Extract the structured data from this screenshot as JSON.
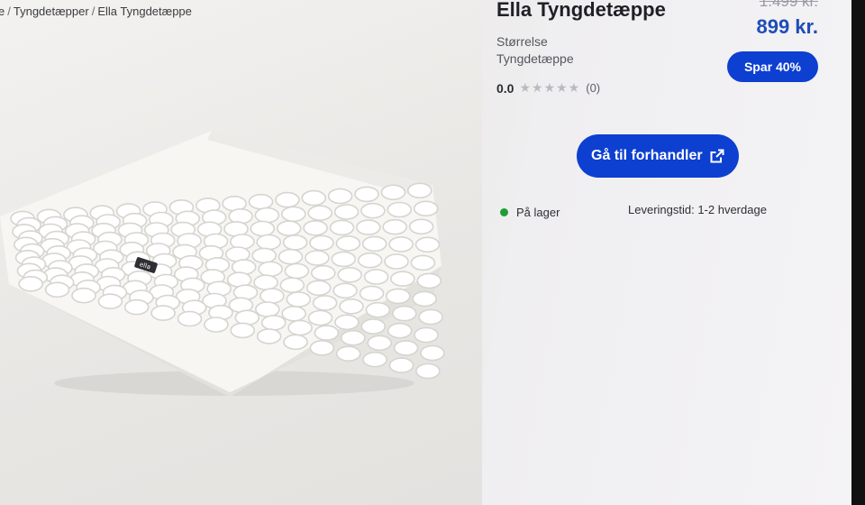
{
  "breadcrumb": {
    "items": [
      "e",
      "Tyngdetæpper",
      "Ella Tyngdetæppe"
    ],
    "separator": "/"
  },
  "product": {
    "title": "Ella Tyngdetæppe",
    "old_price": "1.499 kr.",
    "price": "899 kr.",
    "size_label": "Størrelse",
    "size_value": "Tyngdetæppe",
    "save_badge": "Spar 40%",
    "rating_value": "0.0",
    "stars": "★★★★★",
    "review_count": "(0)",
    "cta_label": "Gå til forhandler",
    "stock_label": "På lager",
    "delivery": "Leveringstid: 1-2 hverdage"
  },
  "colors": {
    "accent": "#0d3fd1",
    "price": "#1e4db7",
    "in_stock": "#1e9d32"
  },
  "icons": {
    "cta": "external-link-icon",
    "stock": "in-stock-dot-icon"
  }
}
